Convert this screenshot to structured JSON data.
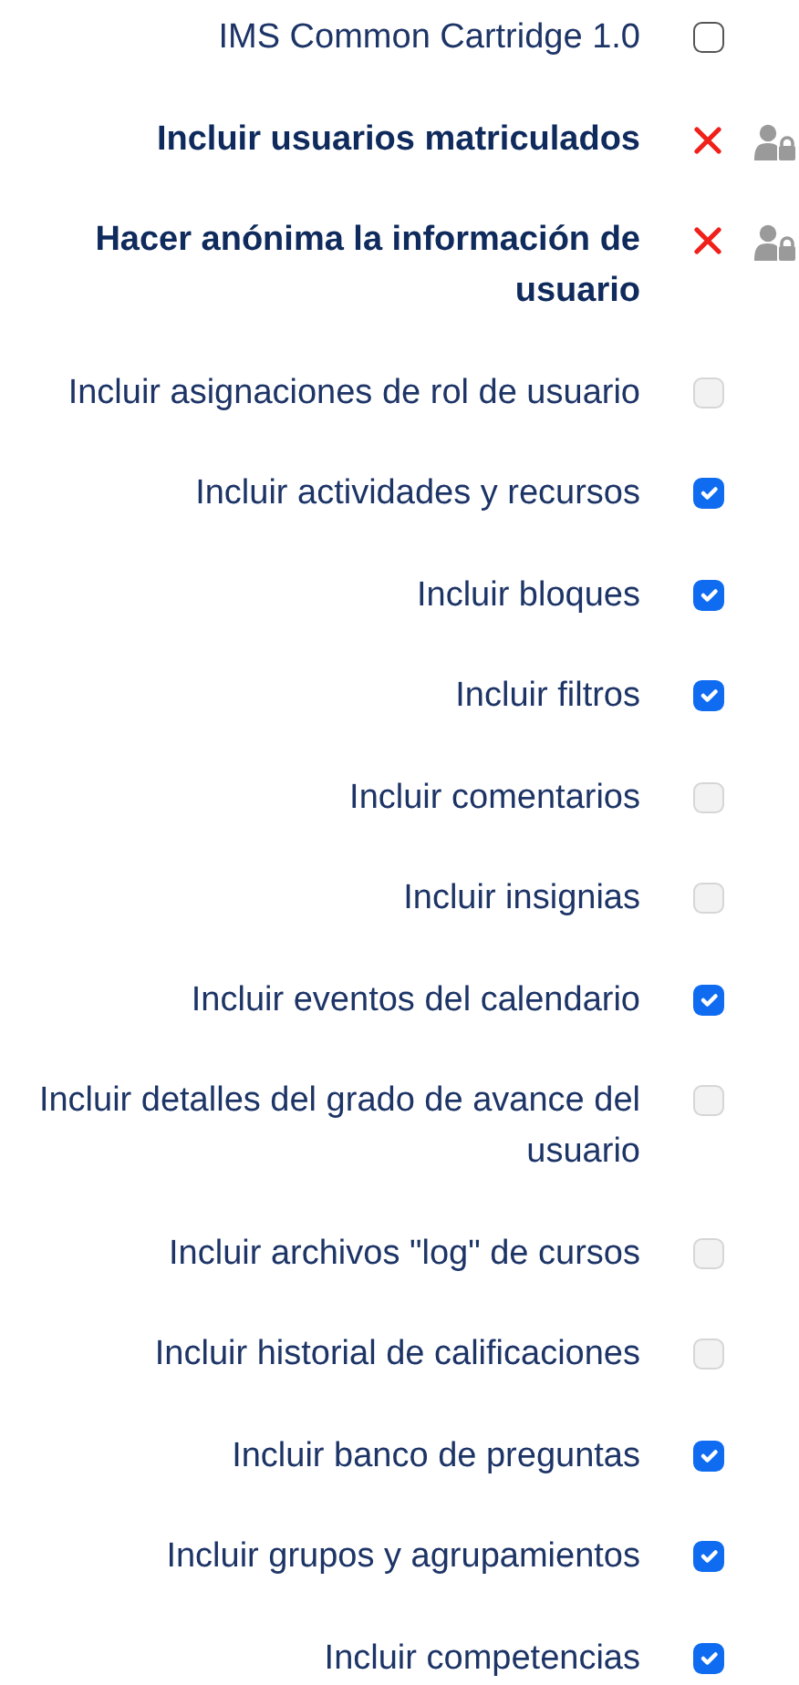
{
  "options": [
    {
      "kind": "checkbox",
      "label": "IMS Common Cartridge 1.0",
      "checked": false,
      "disabled": false
    },
    {
      "kind": "locked",
      "label": "Incluir usuarios matriculados"
    },
    {
      "kind": "locked",
      "label": "Hacer anónima la información de usuario"
    },
    {
      "kind": "checkbox",
      "label": "Incluir asignaciones de rol de usuario",
      "checked": false,
      "disabled": true
    },
    {
      "kind": "checkbox",
      "label": "Incluir actividades y recursos",
      "checked": true,
      "disabled": false
    },
    {
      "kind": "checkbox",
      "label": "Incluir bloques",
      "checked": true,
      "disabled": false
    },
    {
      "kind": "checkbox",
      "label": "Incluir filtros",
      "checked": true,
      "disabled": false
    },
    {
      "kind": "checkbox",
      "label": "Incluir comentarios",
      "checked": false,
      "disabled": true
    },
    {
      "kind": "checkbox",
      "label": "Incluir insignias",
      "checked": false,
      "disabled": true
    },
    {
      "kind": "checkbox",
      "label": "Incluir eventos del calendario",
      "checked": true,
      "disabled": false
    },
    {
      "kind": "checkbox",
      "label": "Incluir detalles del grado de avance del usuario",
      "checked": false,
      "disabled": true
    },
    {
      "kind": "checkbox",
      "label": "Incluir archivos \"log\" de cursos",
      "checked": false,
      "disabled": true
    },
    {
      "kind": "checkbox",
      "label": "Incluir historial de calificaciones",
      "checked": false,
      "disabled": true
    },
    {
      "kind": "checkbox",
      "label": "Incluir banco de preguntas",
      "checked": true,
      "disabled": false
    },
    {
      "kind": "checkbox",
      "label": "Incluir grupos y agrupamientos",
      "checked": true,
      "disabled": false
    },
    {
      "kind": "checkbox",
      "label": "Incluir competencias",
      "checked": true,
      "disabled": false
    }
  ]
}
